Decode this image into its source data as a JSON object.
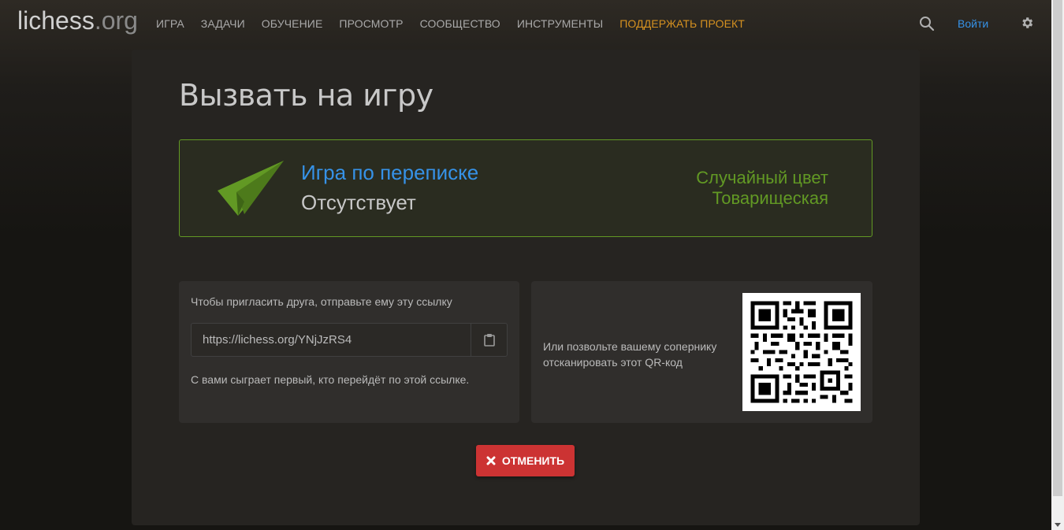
{
  "header": {
    "logo_main": "lichess",
    "logo_tld": ".org",
    "nav": [
      "Игра",
      "Задачи",
      "Обучение",
      "Просмотр",
      "Сообщество",
      "Инструменты"
    ],
    "donate": "Поддержать проект",
    "login": "Войти",
    "icons": [
      "search-icon",
      "gear-icon"
    ]
  },
  "challenge": {
    "title": "Вызвать на игру",
    "variant": "Игра по переписке",
    "time_control": "Отсутствует",
    "color": "Случайный цвет",
    "mode": "Товарищеская",
    "icon": "paper-plane-icon"
  },
  "invite": {
    "instruction": "Чтобы пригласить друга, отправьте ему эту ссылку",
    "url": "https://lichess.org/YNjJzRS4",
    "copy_icon": "clipboard-icon",
    "note": "С вами сыграет первый, кто перейдёт по этой ссылке."
  },
  "qr": {
    "text": "Или позвольте вашему сопернику отсканировать этот QR-код"
  },
  "actions": {
    "cancel": "Отменить",
    "cancel_icon": "x-icon"
  },
  "colors": {
    "accent_blue": "#3692e7",
    "accent_green": "#629924",
    "donate": "#d59120",
    "cancel_red": "#cc3333"
  }
}
